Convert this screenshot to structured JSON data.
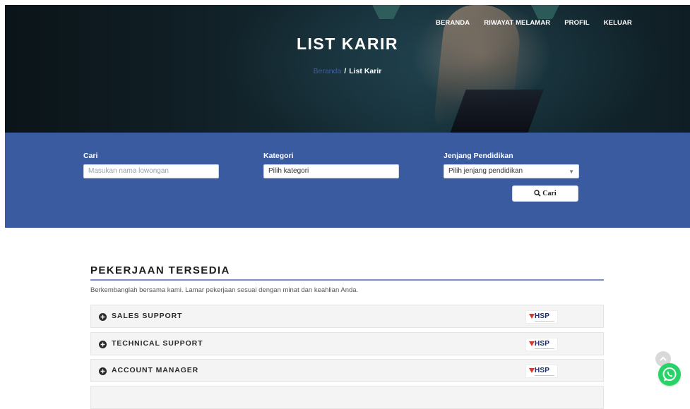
{
  "nav": {
    "items": [
      "BERANDA",
      "RIWAYAT MELAMAR",
      "PROFIL",
      "KELUAR"
    ]
  },
  "hero": {
    "title": "LIST KARIR",
    "breadcrumb_home": "Beranda",
    "breadcrumb_separator": "/",
    "breadcrumb_current": "List Karir"
  },
  "search": {
    "cari_label": "Cari",
    "cari_placeholder": "Masukan nama lowongan",
    "kategori_label": "Kategori",
    "kategori_value": "Pilih kategori",
    "jenjang_label": "Jenjang Pendidikan",
    "jenjang_value": "Pilih jenjang pendidikan",
    "button_label": "Cari"
  },
  "jobs": {
    "title": "PEKERJAAN TERSEDIA",
    "subtitle": "Berkembanglah bersama kami. Lamar pekerjaan sesuai dengan minat dan keahlian Anda.",
    "items": [
      {
        "title": "SALES SUPPORT",
        "logo": "HSP"
      },
      {
        "title": "TECHNICAL SUPPORT",
        "logo": "HSP"
      },
      {
        "title": "ACCOUNT MANAGER",
        "logo": "HSP"
      }
    ]
  },
  "colors": {
    "band": "#3a5ba0",
    "rule": "#7d8fc4",
    "whatsapp": "#25d366"
  },
  "icons": [
    "plus-circle-icon",
    "search-icon",
    "whatsapp-icon",
    "chevron-up-icon",
    "caret-down-icon"
  ]
}
